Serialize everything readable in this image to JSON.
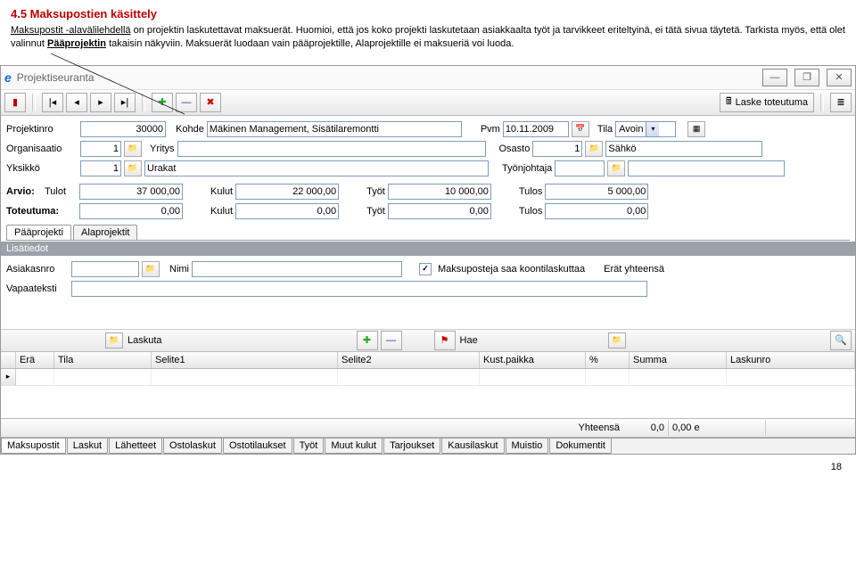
{
  "doc": {
    "heading": "4.5 Maksupostien käsittely",
    "p1a": "Maksupostit -alavälilehdellä",
    "p1b": " on projektin laskutettavat maksuerät. Huomioi, että jos koko projekti laskutetaan asiakkaalta työt ja tarvikkeet eriteltyinä, ei tätä sivua täytetä. Tarkista myös, että olet valinnut ",
    "p1c": "Pääprojektin",
    "p1d": " takaisin näkyviin. Maksuerät luodaan vain pääprojektille, Alaprojektille ei maksueriä voi luoda.",
    "pagenum": "18"
  },
  "title": "Projektiseuranta",
  "toolbar": {
    "laske": "Laske toteutuma"
  },
  "form": {
    "projektnro_lbl": "Projektinro",
    "projektnro": "30000",
    "kohde_lbl": "Kohde",
    "kohde": "Mäkinen Management, Sisätilaremontti",
    "pvm_lbl": "Pvm",
    "pvm": "10.11.2009",
    "tila_lbl": "Tila",
    "tila": "Avoin",
    "organisaatio_lbl": "Organisaatio",
    "organisaatio": "1",
    "yritys_lbl": "Yritys",
    "yritys": "",
    "osasto_lbl": "Osasto",
    "osasto": "1",
    "osasto_name": "Sähkö",
    "yksikko_lbl": "Yksikkö",
    "yksikko": "1",
    "yksikko_name": "Urakat",
    "tyonjohtaja_lbl": "Työnjohtaja",
    "arvio": "Arvio:",
    "tulot_lbl": "Tulot",
    "tulot": "37 000,00",
    "kulut_lbl": "Kulut",
    "kulut": "22 000,00",
    "tyot_lbl": "Työt",
    "tyot": "10 000,00",
    "tulos_lbl": "Tulos",
    "tulos": "5 000,00",
    "toteutuma": "Toteutuma:",
    "t_tulot": "0,00",
    "t_kulut": "0,00",
    "t_tyot": "0,00",
    "t_tulos": "0,00"
  },
  "tabs": {
    "paaprojekti": "Pääprojekti",
    "alaprojektit": "Alaprojektit"
  },
  "section": "Lisätiedot",
  "lis": {
    "asiakasnro_lbl": "Asiakasnro",
    "nimi_lbl": "Nimi",
    "koontilask": "Maksuposteja saa koontilaskuttaa",
    "erat_lbl": "Erät yhteensä",
    "vapaateksti_lbl": "Vapaateksti"
  },
  "tbar2": {
    "laskuta": "Laskuta",
    "hae": "Hae"
  },
  "grid": {
    "era": "Erä",
    "tila": "Tila",
    "selite1": "Selite1",
    "selite2": "Selite2",
    "kust": "Kust.paikka",
    "pct": "%",
    "summa": "Summa",
    "laskunro": "Laskunro"
  },
  "total": {
    "lbl": "Yhteensä",
    "pct": "0,0",
    "sum": "0,00 e"
  },
  "btabs": [
    "Maksupostit",
    "Laskut",
    "Lähetteet",
    "Ostolaskut",
    "Ostotilaukset",
    "Työt",
    "Muut kulut",
    "Tarjoukset",
    "Kausilaskut",
    "Muistio",
    "Dokumentit"
  ]
}
